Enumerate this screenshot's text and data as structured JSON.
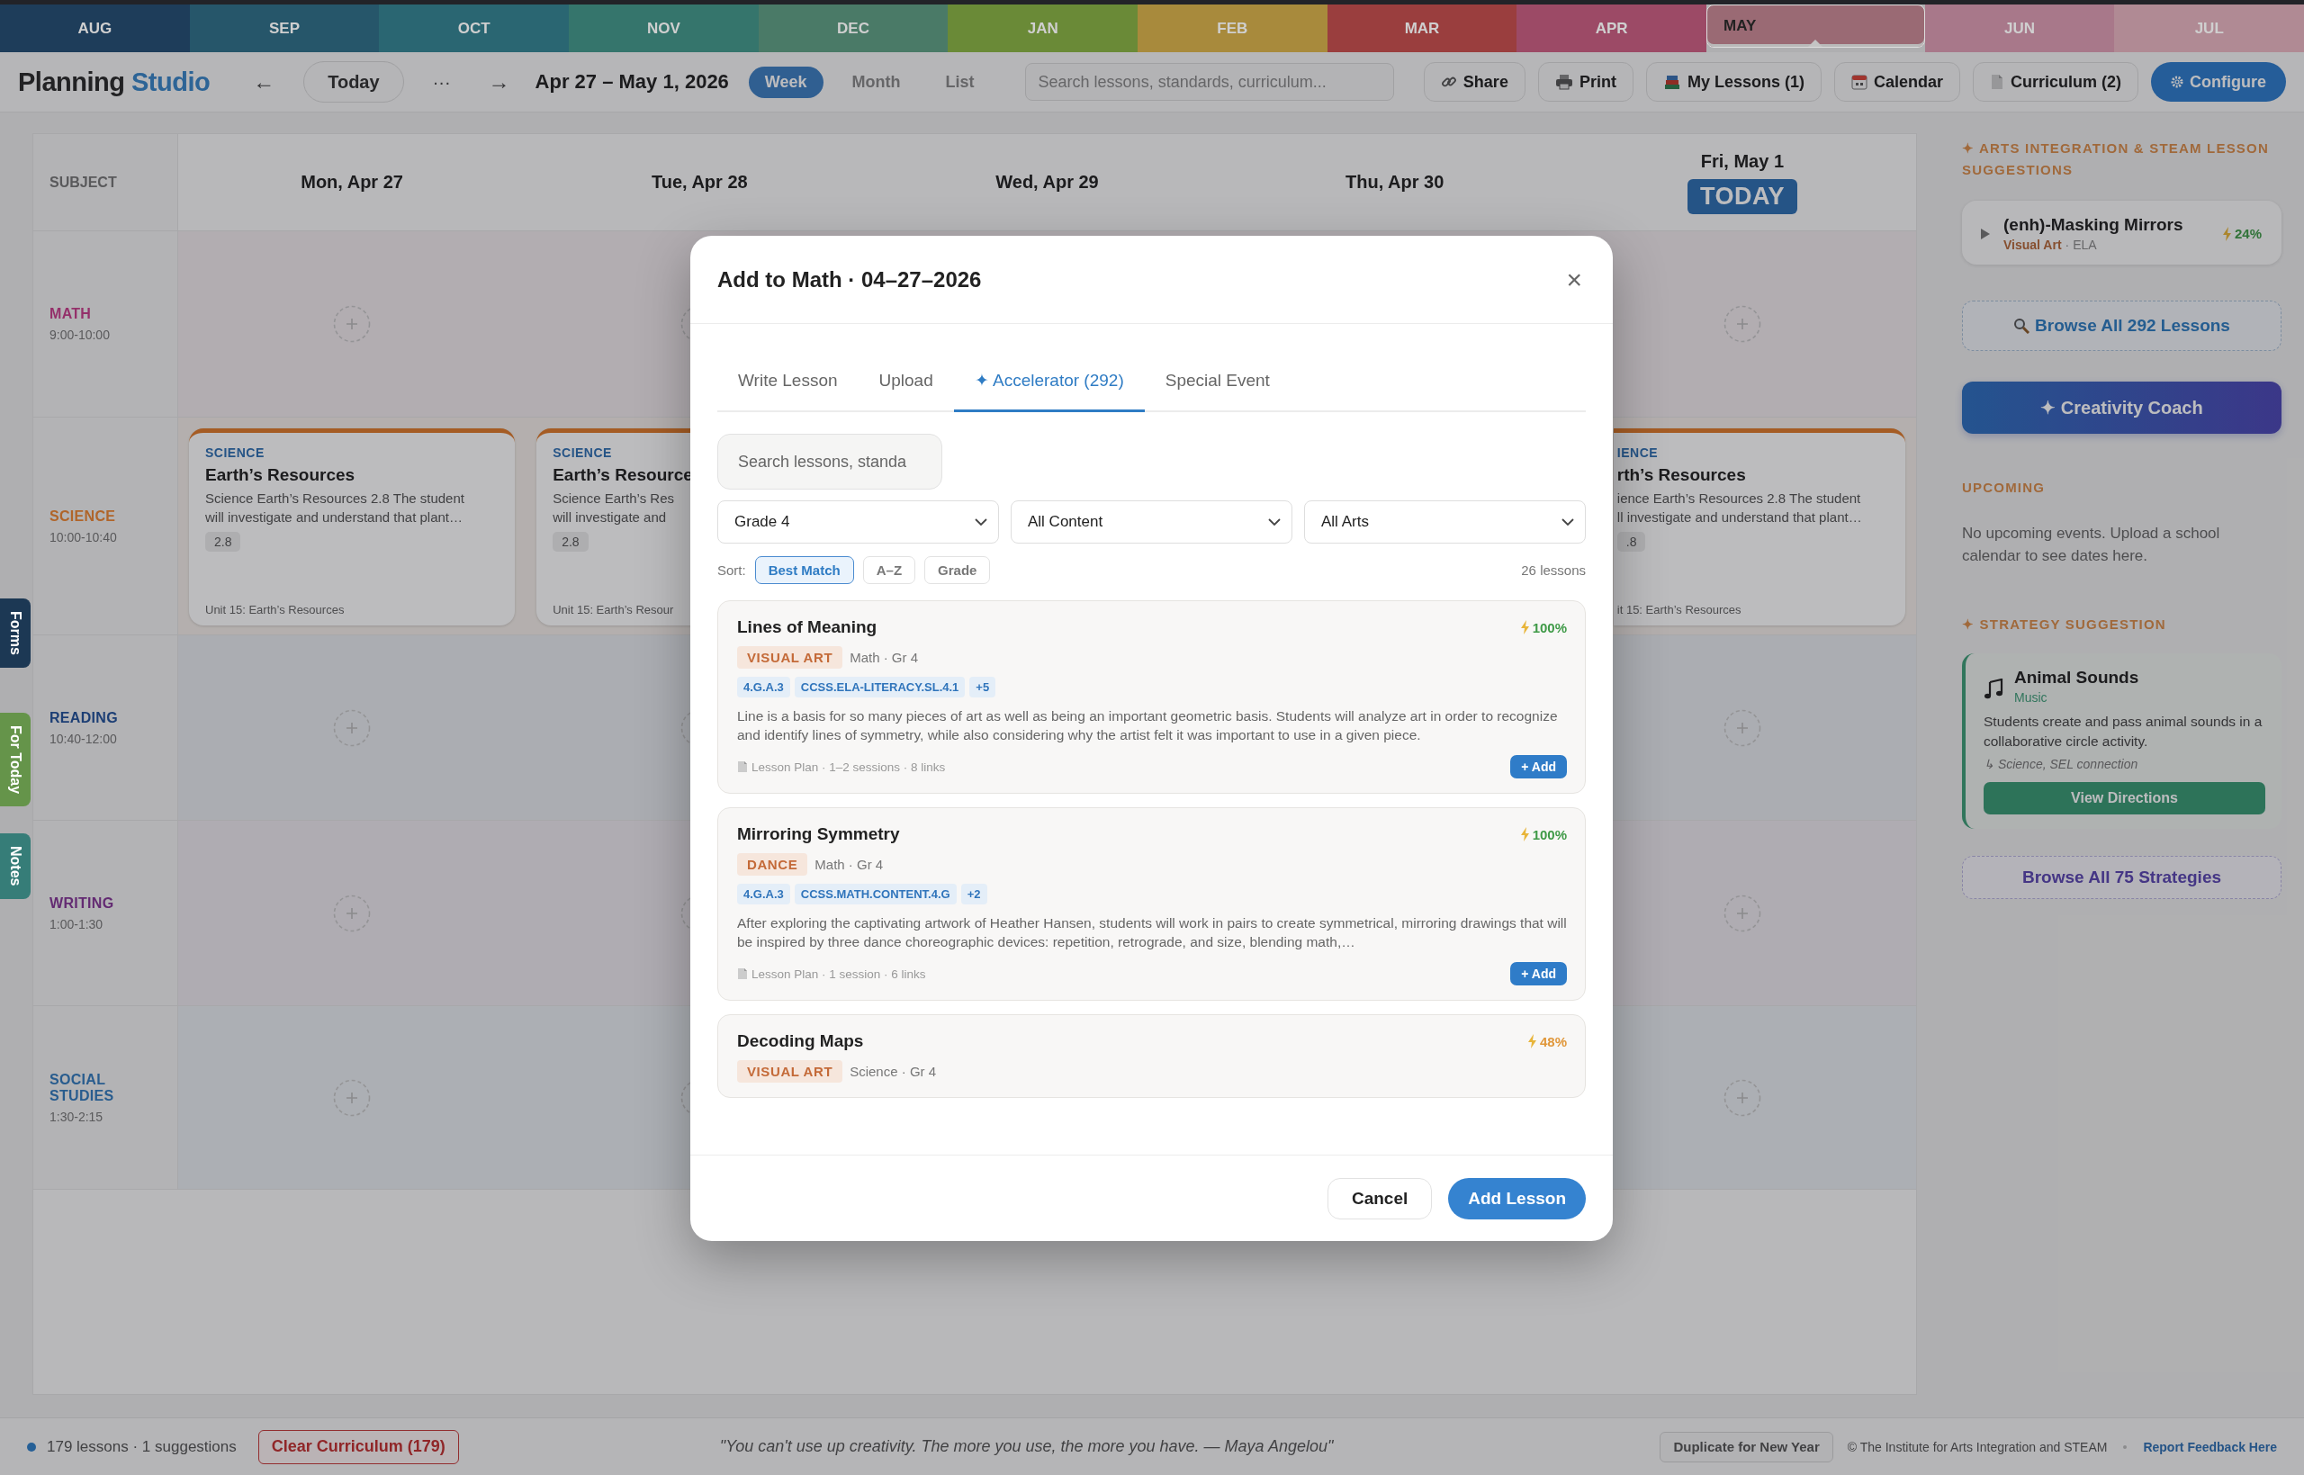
{
  "months": [
    {
      "label": "AUG",
      "color": "#1e3d5a",
      "selected": false
    },
    {
      "label": "SEP",
      "color": "#26566a",
      "selected": false
    },
    {
      "label": "OCT",
      "color": "#2a6672",
      "selected": false
    },
    {
      "label": "NOV",
      "color": "#35756c",
      "selected": false
    },
    {
      "label": "DEC",
      "color": "#4a7a67",
      "selected": false
    },
    {
      "label": "JAN",
      "color": "#6a8a37",
      "selected": false
    },
    {
      "label": "FEB",
      "color": "#a88a3c",
      "selected": false
    },
    {
      "label": "MAR",
      "color": "#9a3e3e",
      "selected": false
    },
    {
      "label": "APR",
      "color": "#9c4a66",
      "selected": false
    },
    {
      "label": "MAY",
      "color": "#9a6a74",
      "selected": true
    },
    {
      "label": "JUN",
      "color": "#a8788a",
      "selected": false
    },
    {
      "label": "JUL",
      "color": "#b08a94",
      "selected": false
    }
  ],
  "toolbar": {
    "brand": "Planning",
    "brand_accent": "Studio",
    "prev": "←",
    "today": "Today",
    "more": "···",
    "next": "→",
    "range": "Apr 27 – May 1, 2026",
    "views": [
      {
        "label": "Week",
        "selected": true
      },
      {
        "label": "Month",
        "selected": false
      },
      {
        "label": "List",
        "selected": false
      }
    ],
    "search": {
      "placeholder": "Search lessons, standards, curriculum..."
    },
    "actions": [
      {
        "label": "Share",
        "kind": "plain"
      },
      {
        "label": "Print",
        "kind": "plain"
      },
      {
        "label": "My Lessons (1)",
        "kind": "plain"
      },
      {
        "label": "Calendar",
        "kind": "plain"
      },
      {
        "label": "Curriculum (2)",
        "kind": "plain"
      },
      {
        "label": "Configure",
        "kind": "primary"
      }
    ]
  },
  "calendar": {
    "subject_heading": "SUBJECT",
    "days": [
      {
        "label": "Mon, Apr 27"
      },
      {
        "label": "Tue, Apr 28"
      },
      {
        "label": "Wed, Apr 29"
      },
      {
        "label": "Thu, Apr 30"
      },
      {
        "label": "Fri, May 1",
        "badge": "TODAY"
      }
    ],
    "rows": [
      {
        "subject": "MATH",
        "time": "9:00-10:00",
        "color": "#94306a",
        "cells": [
          {
            "kind": "add"
          },
          {
            "kind": "add"
          },
          {
            "kind": "blank"
          },
          {
            "kind": "blank"
          },
          {
            "kind": "add"
          }
        ]
      },
      {
        "subject": "SCIENCE",
        "time": "10:00-10:40",
        "color": "#b0652a",
        "cells": [
          {
            "kind": "lesson",
            "tag": "SCIENCE",
            "title": "Earth’s Resources",
            "lines": [
              "Science Earth’s Resources 2.8 The student",
              "will investigate and understand that plant…"
            ],
            "code": "2.8",
            "unit": "Unit 15: Earth’s Resources"
          },
          {
            "kind": "lesson",
            "tag": "SCIENCE",
            "title": "Earth’s Resource",
            "lines": [
              "Science Earth’s Res",
              "will investigate and"
            ],
            "code": "2.8",
            "unit": "Unit 15: Earth’s Resour"
          },
          {
            "kind": "blank"
          },
          {
            "kind": "blank"
          },
          {
            "kind": "lesson",
            "tag": "IENCE",
            "title": "rth’s Resources",
            "lines": [
              "ience Earth’s Resources 2.8 The student",
              "ll investigate and understand that plant…"
            ],
            "code": ".8",
            "unit": "it 15: Earth’s Resources"
          }
        ]
      },
      {
        "subject": "READING",
        "time": "10:40-12:00",
        "color": "#1c3e74",
        "cells": [
          {
            "kind": "add"
          },
          {
            "kind": "add"
          },
          {
            "kind": "blank"
          },
          {
            "kind": "blank"
          },
          {
            "kind": "add"
          }
        ]
      },
      {
        "subject": "WRITING",
        "time": "1:00-1:30",
        "color": "#632a72",
        "cells": [
          {
            "kind": "add"
          },
          {
            "kind": "add"
          },
          {
            "kind": "blank"
          },
          {
            "kind": "blank"
          },
          {
            "kind": "add"
          }
        ]
      },
      {
        "subject": "SOCIAL STUDIES",
        "time": "1:30-2:15",
        "color": "#285c8e",
        "cells": [
          {
            "kind": "add"
          },
          {
            "kind": "add"
          },
          {
            "kind": "blank"
          },
          {
            "kind": "blank"
          },
          {
            "kind": "add"
          }
        ]
      }
    ]
  },
  "side_tabs": [
    {
      "label": "Forms",
      "color": "#1c3854"
    },
    {
      "label": "For Today",
      "color": "#65944a"
    },
    {
      "label": "Notes",
      "color": "#367d78"
    }
  ],
  "modal": {
    "title": "Add to Math · 04–27–2026",
    "close": "×",
    "tabs": [
      {
        "label": "Write Lesson",
        "selected": false
      },
      {
        "label": "Upload",
        "selected": false
      },
      {
        "label": "✦ Accelerator (292)",
        "selected": true
      },
      {
        "label": "Special Event",
        "selected": false
      }
    ],
    "search": {
      "placeholder": "Search lessons, standa"
    },
    "filters": [
      {
        "value": "Grade 4"
      },
      {
        "value": "All Content"
      },
      {
        "value": "All Arts"
      }
    ],
    "sort_label": "Sort:",
    "sort_options": [
      {
        "label": "Best Match",
        "selected": true
      },
      {
        "label": "A–Z",
        "selected": false
      },
      {
        "label": "Grade",
        "selected": false
      }
    ],
    "count": "26 lessons",
    "lessons": [
      {
        "title": "Lines of Meaning",
        "match": "100%",
        "color": "#3f9a47",
        "art": "VISUAL ART",
        "meta": "Math · Gr 4",
        "standards": [
          "4.G.A.3",
          "CCSS.ELA-LITERACY.SL.4.1"
        ],
        "more": "+5",
        "description": "Line is a basis for so many pieces of art as well as being an important geometric basis. Students will analyze art in order to recognize and identify lines of symmetry, while also considering why the artist felt it was important to use in a given piece.",
        "footer": "Lesson Plan · 1–2 sessions · 8 links",
        "add": "+ Add"
      },
      {
        "title": "Mirroring Symmetry",
        "match": "100%",
        "color": "#3f9a47",
        "art": "DANCE",
        "meta": "Math · Gr 4",
        "standards": [
          "4.G.A.3",
          "CCSS.MATH.CONTENT.4.G"
        ],
        "more": "+2",
        "description": "After exploring the captivating artwork of Heather Hansen, students will work in pairs to create symmetrical, mirroring drawings that will be inspired by three dance choreographic devices: repetition, retrograde, and size, blending math,…",
        "footer": "Lesson Plan · 1 session · 6 links",
        "add": "+ Add"
      },
      {
        "title": "Decoding Maps",
        "match": "48%",
        "color": "#e0973a",
        "art": "VISUAL ART",
        "meta": "Science · Gr 4"
      }
    ],
    "cancel": "Cancel",
    "submit": "Add Lesson"
  },
  "sidebar": {
    "suggestions_heading": "✦ ARTS INTEGRATION & STEAM LESSON SUGGESTIONS",
    "suggestion": {
      "title": "(enh)-Masking Mirrors",
      "art": "Visual Art",
      "meta": "· ELA",
      "match": "24%"
    },
    "browse_lessons": "Browse All 292 Lessons",
    "coach": "✦ Creativity Coach",
    "upcoming_heading": "UPCOMING",
    "upcoming_text": "No upcoming events. Upload a school calendar to see dates here.",
    "strategy_heading": "✦ STRATEGY SUGGESTION",
    "strategy": {
      "title": "Animal Sounds",
      "art": "Music",
      "description": "Students create and pass animal sounds in a collaborative circle activity.",
      "connection": "↳ Science, SEL connection",
      "action": "View Directions"
    },
    "browse_strategies": "Browse All 75 Strategies"
  },
  "status_bar": {
    "summary": "179 lessons · 1 suggestions",
    "clear": "Clear Curriculum (179)",
    "quote": "\"You can't use up creativity. The more you use, the more you have. — Maya Angelou\"",
    "duplicate": "Duplicate for New Year",
    "credit": "© The Institute for Arts Integration and STEAM",
    "feedback": "Report Feedback Here"
  }
}
